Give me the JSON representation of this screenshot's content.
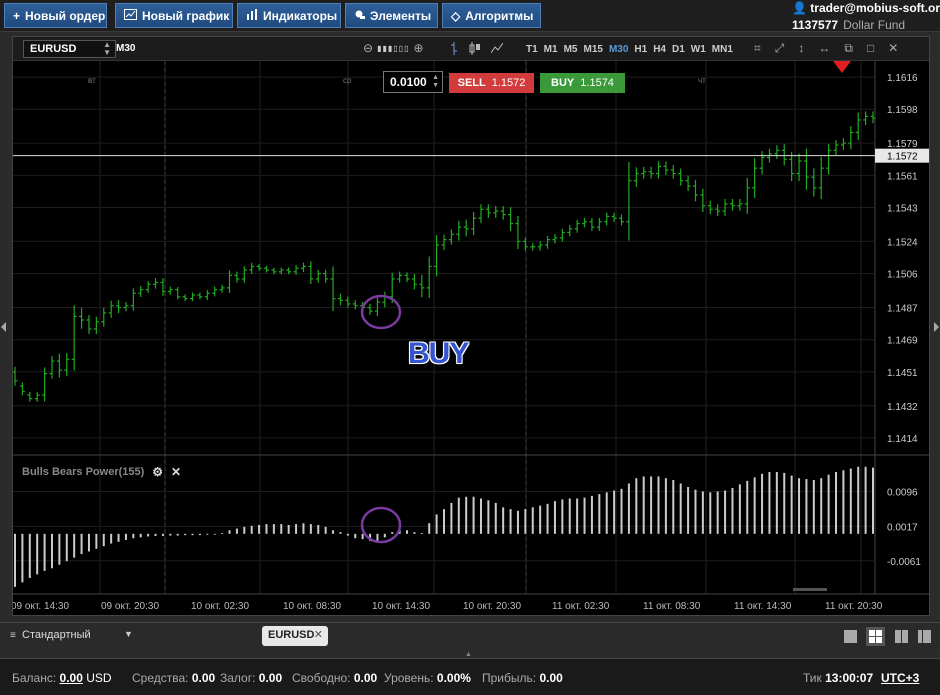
{
  "toolbar": {
    "new_order": "Новый ордер",
    "new_chart": "Новый график",
    "indicators": "Индикаторы",
    "elements": "Элементы",
    "algorithms": "Алгоритмы"
  },
  "account": {
    "user": "trader@mobius-soft.org",
    "number": "1137577",
    "fund": "Dollar Fund"
  },
  "chart_header": {
    "symbol": "EURUSD",
    "timeframe": "M30",
    "timeframes": [
      "T1",
      "M1",
      "M5",
      "M15",
      "M30",
      "H1",
      "H4",
      "D1",
      "W1",
      "MN1"
    ],
    "active_timeframe": "M30"
  },
  "trade": {
    "volume": "0.0100",
    "sell_label": "SELL",
    "sell_price": "1.1572",
    "buy_label": "BUY",
    "buy_price": "1.1574"
  },
  "annotation": {
    "text": "BUY"
  },
  "indicator": {
    "name": "Bulls Bears Power(155)"
  },
  "chart_data": [
    {
      "type": "ohlc",
      "symbol": "EURUSD",
      "timeframe": "M30",
      "y_ticks": [
        "1.1616",
        "1.1598",
        "1.1579",
        "1.1561",
        "1.1543",
        "1.1524",
        "1.1506",
        "1.1487",
        "1.1469",
        "1.1451",
        "1.1432",
        "1.1414"
      ],
      "ylim": [
        1.1405,
        1.1625
      ],
      "current_price": "1.1572",
      "day_labels": [
        "вт",
        "ср",
        "чт"
      ],
      "x_ticks": [
        "09 окт. 14:30",
        "09 окт. 20:30",
        "10 окт. 02:30",
        "10 окт. 08:30",
        "10 окт. 14:30",
        "10 окт. 20:30",
        "11 окт. 02:30",
        "11 окт. 08:30",
        "11 окт. 14:30",
        "11 окт. 20:30"
      ],
      "bar_color": "#22aa22",
      "close": [
        1.1446,
        1.144,
        1.1436,
        1.1438,
        1.145,
        1.1457,
        1.1452,
        1.1458,
        1.1482,
        1.148,
        1.1475,
        1.1479,
        1.1484,
        1.1488,
        1.1487,
        1.1488,
        1.1495,
        1.1497,
        1.15,
        1.1501,
        1.1496,
        1.1497,
        1.1493,
        1.1492,
        1.1494,
        1.1493,
        1.1495,
        1.1497,
        1.1498,
        1.1505,
        1.1503,
        1.1508,
        1.151,
        1.1509,
        1.1508,
        1.1507,
        1.1508,
        1.1507,
        1.1509,
        1.151,
        1.1503,
        1.1506,
        1.1503,
        1.1492,
        1.1491,
        1.1489,
        1.1488,
        1.1487,
        1.1485,
        1.149,
        1.1493,
        1.1503,
        1.1505,
        1.1503,
        1.15,
        1.1498,
        1.151,
        1.1522,
        1.1525,
        1.1528,
        1.1532,
        1.1531,
        1.1537,
        1.1542,
        1.154,
        1.1541,
        1.1539,
        1.1534,
        1.1524,
        1.1521,
        1.1521,
        1.1522,
        1.1525,
        1.1526,
        1.1529,
        1.1531,
        1.1534,
        1.1535,
        1.1532,
        1.1535,
        1.1538,
        1.1537,
        1.1535,
        1.1558,
        1.1562,
        1.1563,
        1.1562,
        1.1566,
        1.1564,
        1.1562,
        1.1558,
        1.1555,
        1.155,
        1.1544,
        1.1542,
        1.1541,
        1.1545,
        1.1544,
        1.1545,
        1.1554,
        1.1565,
        1.1571,
        1.1573,
        1.1575,
        1.157,
        1.1562,
        1.1569,
        1.156,
        1.1554,
        1.1565,
        1.1575,
        1.1578,
        1.1579,
        1.1585,
        1.1592,
        1.1594,
        1.1593
      ],
      "open": [
        1.1451,
        1.1443,
        1.1438,
        1.1436,
        1.1438,
        1.145,
        1.1457,
        1.1452,
        1.1458,
        1.1482,
        1.148,
        1.1475,
        1.1479,
        1.1484,
        1.1488,
        1.1487,
        1.1488,
        1.1495,
        1.1497,
        1.15,
        1.1501,
        1.1496,
        1.1497,
        1.1493,
        1.1492,
        1.1494,
        1.1493,
        1.1495,
        1.1497,
        1.1498,
        1.1505,
        1.1503,
        1.1508,
        1.151,
        1.1509,
        1.1508,
        1.1507,
        1.1508,
        1.1507,
        1.1509,
        1.151,
        1.1503,
        1.1506,
        1.1503,
        1.1492,
        1.1491,
        1.1489,
        1.1488,
        1.1487,
        1.1485,
        1.149,
        1.1493,
        1.1503,
        1.1505,
        1.1503,
        1.15,
        1.1498,
        1.151,
        1.1522,
        1.1525,
        1.1528,
        1.1532,
        1.1531,
        1.1537,
        1.1542,
        1.154,
        1.1541,
        1.1539,
        1.1534,
        1.1524,
        1.1521,
        1.1521,
        1.1522,
        1.1525,
        1.1526,
        1.1529,
        1.1531,
        1.1534,
        1.1535,
        1.1532,
        1.1535,
        1.1538,
        1.1537,
        1.1535,
        1.1558,
        1.1562,
        1.1563,
        1.1562,
        1.1566,
        1.1564,
        1.1562,
        1.1558,
        1.1555,
        1.155,
        1.1544,
        1.1542,
        1.1541,
        1.1545,
        1.1544,
        1.1545,
        1.1554,
        1.1565,
        1.1571,
        1.1573,
        1.1575,
        1.157,
        1.1562,
        1.1569,
        1.156,
        1.1554,
        1.1565,
        1.1575,
        1.1578,
        1.1579,
        1.1585,
        1.1592,
        1.1594
      ],
      "range": [
        0.0008,
        0.0006,
        0.0005,
        0.0005,
        0.001,
        0.0008,
        0.0012,
        0.001,
        0.0018,
        0.0014,
        0.0008,
        0.0008,
        0.0008,
        0.0008,
        0.0009,
        0.0006,
        0.0008,
        0.0006,
        0.0005,
        0.0007,
        0.0007,
        0.0005,
        0.0004,
        0.0004,
        0.0004,
        0.0004,
        0.0005,
        0.0005,
        0.0005,
        0.0008,
        0.0006,
        0.0006,
        0.0006,
        0.0004,
        0.0004,
        0.0004,
        0.0004,
        0.0004,
        0.0005,
        0.0006,
        0.0008,
        0.0006,
        0.0006,
        0.002,
        0.0008,
        0.0006,
        0.0006,
        0.0006,
        0.0006,
        0.0008,
        0.0008,
        0.001,
        0.0006,
        0.0005,
        0.0008,
        0.0015,
        0.0016,
        0.0016,
        0.0008,
        0.0008,
        0.001,
        0.0012,
        0.001,
        0.0008,
        0.0008,
        0.0008,
        0.0008,
        0.0012,
        0.0012,
        0.0006,
        0.0006,
        0.0006,
        0.0006,
        0.0006,
        0.0006,
        0.0006,
        0.0006,
        0.0006,
        0.0006,
        0.0006,
        0.0006,
        0.0006,
        0.0006,
        0.003,
        0.001,
        0.0008,
        0.0008,
        0.0008,
        0.0008,
        0.0008,
        0.0008,
        0.0008,
        0.001,
        0.001,
        0.0008,
        0.0008,
        0.0008,
        0.0008,
        0.0008,
        0.0016,
        0.0016,
        0.001,
        0.0008,
        0.0008,
        0.001,
        0.0012,
        0.0012,
        0.002,
        0.0014,
        0.0018,
        0.001,
        0.0008,
        0.0008,
        0.001,
        0.0012,
        0.0008,
        0.0008
      ]
    },
    {
      "type": "bar",
      "name": "Bulls Bears Power(155)",
      "y_ticks": [
        "0.0096",
        "0.0017",
        "-0.0061"
      ],
      "ylim": [
        -0.0125,
        0.0165
      ],
      "bar_color": "#cccccc",
      "values": [
        -0.012,
        -0.011,
        -0.01,
        -0.0092,
        -0.0084,
        -0.0078,
        -0.007,
        -0.0062,
        -0.0054,
        -0.0046,
        -0.004,
        -0.0034,
        -0.0028,
        -0.0022,
        -0.0018,
        -0.0014,
        -0.001,
        -0.0008,
        -0.0006,
        -0.0005,
        -0.0005,
        -0.0004,
        -0.0004,
        -0.0003,
        -0.0003,
        -0.0003,
        -0.0002,
        -0.0002,
        0.0002,
        0.0008,
        0.0012,
        0.0016,
        0.0018,
        0.002,
        0.0022,
        0.0022,
        0.0022,
        0.002,
        0.0022,
        0.0024,
        0.0022,
        0.002,
        0.0016,
        0.0008,
        0.0004,
        -0.0004,
        -0.001,
        -0.0012,
        -0.0016,
        -0.0018,
        -0.0008,
        0.0004,
        0.0008,
        0.0008,
        0.0004,
        0.0002,
        0.0024,
        0.0044,
        0.0056,
        0.007,
        0.0082,
        0.0084,
        0.0084,
        0.008,
        0.0076,
        0.007,
        0.006,
        0.0056,
        0.0052,
        0.0056,
        0.006,
        0.0064,
        0.0068,
        0.0074,
        0.0078,
        0.008,
        0.008,
        0.0082,
        0.0086,
        0.009,
        0.0094,
        0.0098,
        0.0102,
        0.0114,
        0.0126,
        0.013,
        0.013,
        0.013,
        0.0126,
        0.0122,
        0.0114,
        0.0106,
        0.01,
        0.0096,
        0.0094,
        0.0096,
        0.0098,
        0.0104,
        0.0112,
        0.012,
        0.0128,
        0.0136,
        0.014,
        0.014,
        0.0138,
        0.0132,
        0.0126,
        0.0124,
        0.0122,
        0.0126,
        0.0134,
        0.014,
        0.0144,
        0.0148,
        0.0152,
        0.0152,
        0.015
      ]
    }
  ],
  "bottom": {
    "layout_name": "Стандартный",
    "tab_symbol": "EURUSD"
  },
  "status": {
    "balance_label": "Баланс:",
    "balance_value": "0.00",
    "balance_currency": "USD",
    "funds_label": "Средства:",
    "funds_value": "0.00",
    "margin_label": "Залог:",
    "margin_value": "0.00",
    "free_label": "Свободно:",
    "free_value": "0.00",
    "level_label": "Уровень:",
    "level_value": "0.00%",
    "profit_label": "Прибыль:",
    "profit_value": "0.00",
    "tick_label": "Тик",
    "tick_value": "13:00:07",
    "timezone": "UTC+3"
  }
}
